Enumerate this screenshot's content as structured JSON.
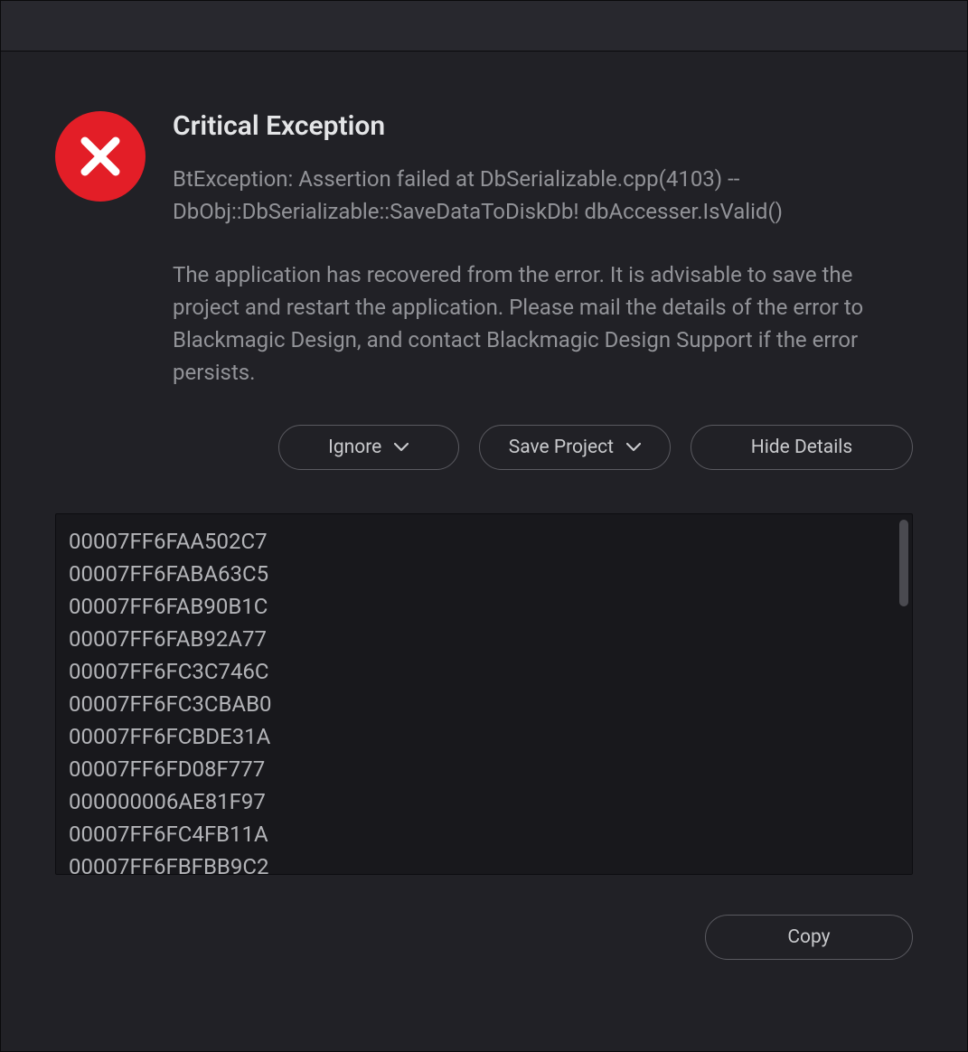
{
  "dialog": {
    "title": "Critical Exception",
    "exception": "BtException: Assertion failed at DbSerializable.cpp(4103) -- DbObj::DbSerializable::SaveDataToDiskDb! dbAccesser.IsValid()",
    "advice": "The application has recovered from the error. It is advisable to save the project and restart the application. Please mail the details of the error to Blackmagic Design, and contact Blackmagic Design Support if the error persists."
  },
  "buttons": {
    "ignore": "Ignore",
    "save_project": "Save Project",
    "hide_details": "Hide Details",
    "copy": "Copy"
  },
  "details": {
    "lines": [
      "00007FF6FAA502C7",
      "00007FF6FABA63C5",
      "00007FF6FAB90B1C",
      "00007FF6FAB92A77",
      "00007FF6FC3C746C",
      "00007FF6FC3CBAB0",
      "00007FF6FCBDE31A",
      "00007FF6FD08F777",
      "000000006AE81F97",
      "00007FF6FC4FB11A",
      "00007FF6FBFBB9C2"
    ]
  },
  "colors": {
    "error_icon_bg": "#e31e27"
  }
}
